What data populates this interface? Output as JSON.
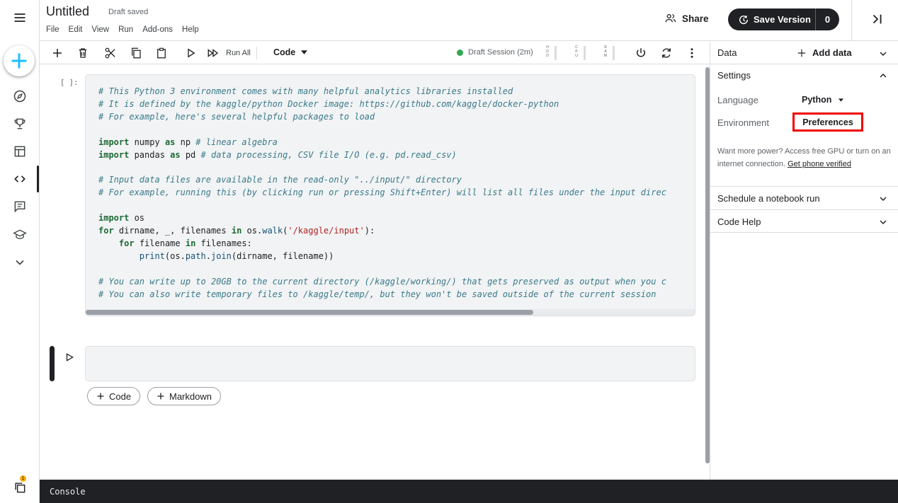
{
  "app": {
    "title": "Untitled",
    "draft_status": "Draft saved"
  },
  "menu": [
    "File",
    "Edit",
    "View",
    "Run",
    "Add-ons",
    "Help"
  ],
  "header": {
    "share_label": "Share",
    "save_version_label": "Save Version",
    "version_count": "0"
  },
  "toolbar": {
    "run_all_label": "Run All",
    "cell_type": "Code",
    "session_label": "Draft Session (2m)",
    "meters": [
      "H D D",
      "C P U",
      "R A M"
    ]
  },
  "rail": {
    "icons": [
      "menu-icon",
      "add-icon",
      "compass-icon",
      "trophy-icon",
      "table-icon",
      "code-icon",
      "comment-icon",
      "school-icon",
      "chevron-down-icon",
      "copy-icon"
    ],
    "notification_badge": "1"
  },
  "cell1": {
    "prompt": "[ ]:",
    "lines": [
      "# This Python 3 environment comes with many helpful analytics libraries installed",
      "# It is defined by the kaggle/python Docker image: https://github.com/kaggle/docker-python",
      "# For example, here's several helpful packages to load",
      "",
      "import numpy as np # linear algebra",
      "import pandas as pd # data processing, CSV file I/O (e.g. pd.read_csv)",
      "",
      "# Input data files are available in the read-only \"../input/\" directory",
      "# For example, running this (by clicking run or pressing Shift+Enter) will list all files under the input direc",
      "",
      "import os",
      "for dirname, _, filenames in os.walk('/kaggle/input'):",
      "    for filename in filenames:",
      "        print(os.path.join(dirname, filename))",
      "",
      "# You can write up to 20GB to the current directory (/kaggle/working/) that gets preserved as output when you c",
      "# You can also write temporary files to /kaggle/temp/, but they won't be saved outside of the current session"
    ]
  },
  "add_buttons": {
    "code": "Code",
    "markdown": "Markdown"
  },
  "console": {
    "label": "Console"
  },
  "panel": {
    "data_label": "Data",
    "add_data_label": "Add data",
    "settings_label": "Settings",
    "language_label": "Language",
    "language_value": "Python",
    "environment_label": "Environment",
    "environment_value": "Preferences",
    "help_text": "Want more power? Access free GPU or turn on an internet connection.",
    "help_link": "Get phone verified",
    "schedule_label": "Schedule a notebook run",
    "code_help_label": "Code Help"
  },
  "colors": {
    "accent": "#20beff",
    "highlight": "#ee0000",
    "session_dot": "#34a853",
    "console_bg": "#202124"
  }
}
